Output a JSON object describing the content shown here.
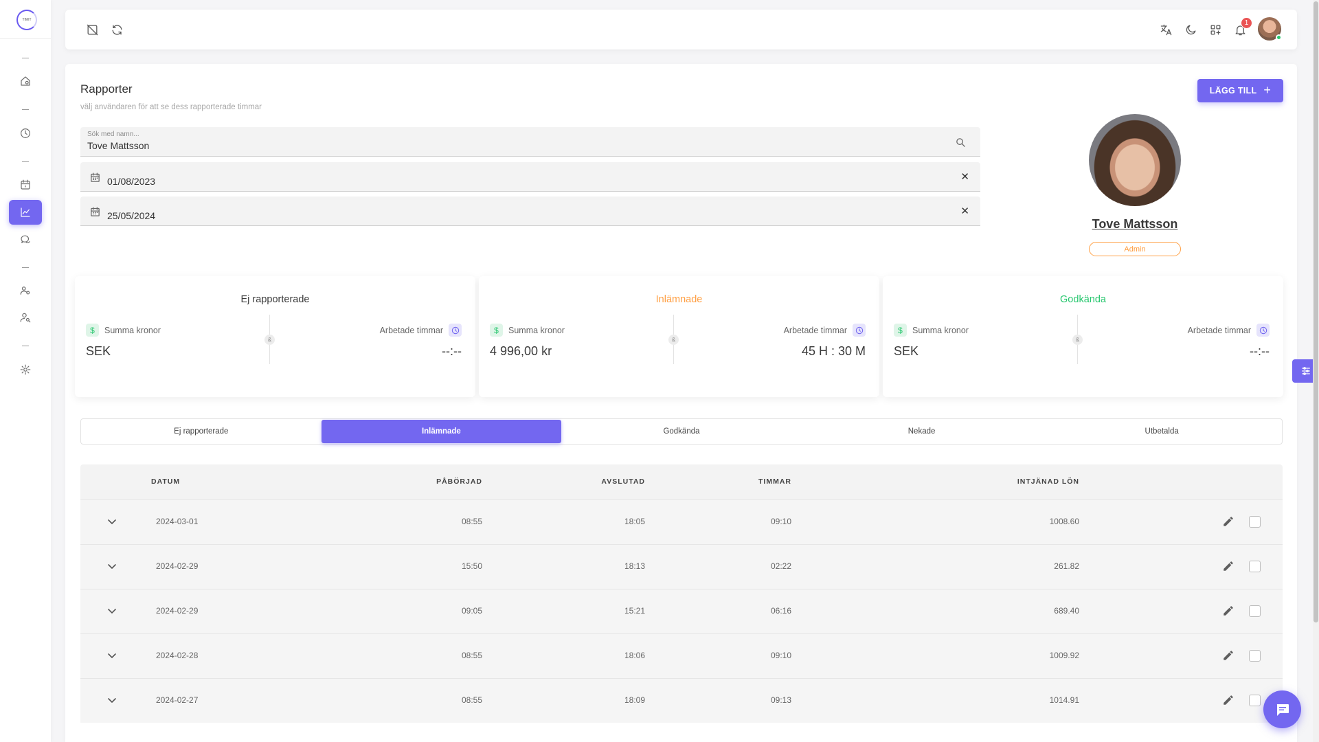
{
  "sidebar": {
    "logo_text": "TIMIT",
    "items": [
      {
        "name": "home",
        "icon": "home-icon",
        "active": false
      },
      {
        "name": "time",
        "icon": "clock-icon",
        "active": false
      },
      {
        "name": "calendar",
        "icon": "calendar-icon",
        "active": false
      },
      {
        "name": "reports",
        "icon": "chart-line-icon",
        "active": true
      },
      {
        "name": "chat",
        "icon": "chat-bubbles-icon",
        "active": false
      },
      {
        "name": "team",
        "icon": "users-settings-icon",
        "active": false
      },
      {
        "name": "user-search",
        "icon": "user-search-icon",
        "active": false
      },
      {
        "name": "settings",
        "icon": "gear-icon",
        "active": false
      }
    ]
  },
  "topbar": {
    "notification_count": "1",
    "icons": [
      "unlink-icon",
      "refresh-icon",
      "translate-icon",
      "moon-icon",
      "apps-add-icon",
      "bell-icon"
    ]
  },
  "page": {
    "title": "Rapporter",
    "subtitle": "välj användaren för att se dess rapporterade timmar",
    "add_button": "LÄGG TILL",
    "search": {
      "label": "Sök med namn...",
      "value": "Tove Mattsson"
    },
    "date_from": "01/08/2023",
    "date_to": "25/05/2024"
  },
  "profile": {
    "name": "Tove Mattsson",
    "role": "Admin"
  },
  "stats": [
    {
      "title": "Ej rapporterade",
      "title_color": "#3a3a3a",
      "sum_label": "Summa kronor",
      "sum_value": "SEK",
      "hours_label": "Arbetade timmar",
      "hours_value": "--:--",
      "separator": "&"
    },
    {
      "title": "Inlämnade",
      "title_color": "#ff9f43",
      "sum_label": "Summa kronor",
      "sum_value": "4 996,00 kr",
      "hours_label": "Arbetade timmar",
      "hours_value": "45 H : 30 M",
      "separator": "&"
    },
    {
      "title": "Godkända",
      "title_color": "#28c76f",
      "sum_label": "Summa kronor",
      "sum_value": "SEK",
      "hours_label": "Arbetade timmar",
      "hours_value": "--:--",
      "separator": "&"
    }
  ],
  "tabs": [
    {
      "label": "Ej rapporterade",
      "active": false
    },
    {
      "label": "Inlämnade",
      "active": true
    },
    {
      "label": "Godkända",
      "active": false
    },
    {
      "label": "Nekade",
      "active": false
    },
    {
      "label": "Utbetalda",
      "active": false
    }
  ],
  "table": {
    "columns": [
      "DATUM",
      "PÅBÖRJAD",
      "AVSLUTAD",
      "TIMMAR",
      "INTJÄNAD LÖN"
    ],
    "rows": [
      [
        "2024-03-01",
        "08:55",
        "18:05",
        "09:10",
        "1008.60"
      ],
      [
        "2024-02-29",
        "15:50",
        "18:13",
        "02:22",
        "261.82"
      ],
      [
        "2024-02-29",
        "09:05",
        "15:21",
        "06:16",
        "689.40"
      ],
      [
        "2024-02-28",
        "08:55",
        "18:06",
        "09:10",
        "1009.92"
      ],
      [
        "2024-02-27",
        "08:55",
        "18:09",
        "09:13",
        "1014.91"
      ]
    ]
  },
  "colors": {
    "accent": "#7367f0",
    "warning": "#ff9f43",
    "success": "#28c76f",
    "danger": "#ea5455"
  }
}
